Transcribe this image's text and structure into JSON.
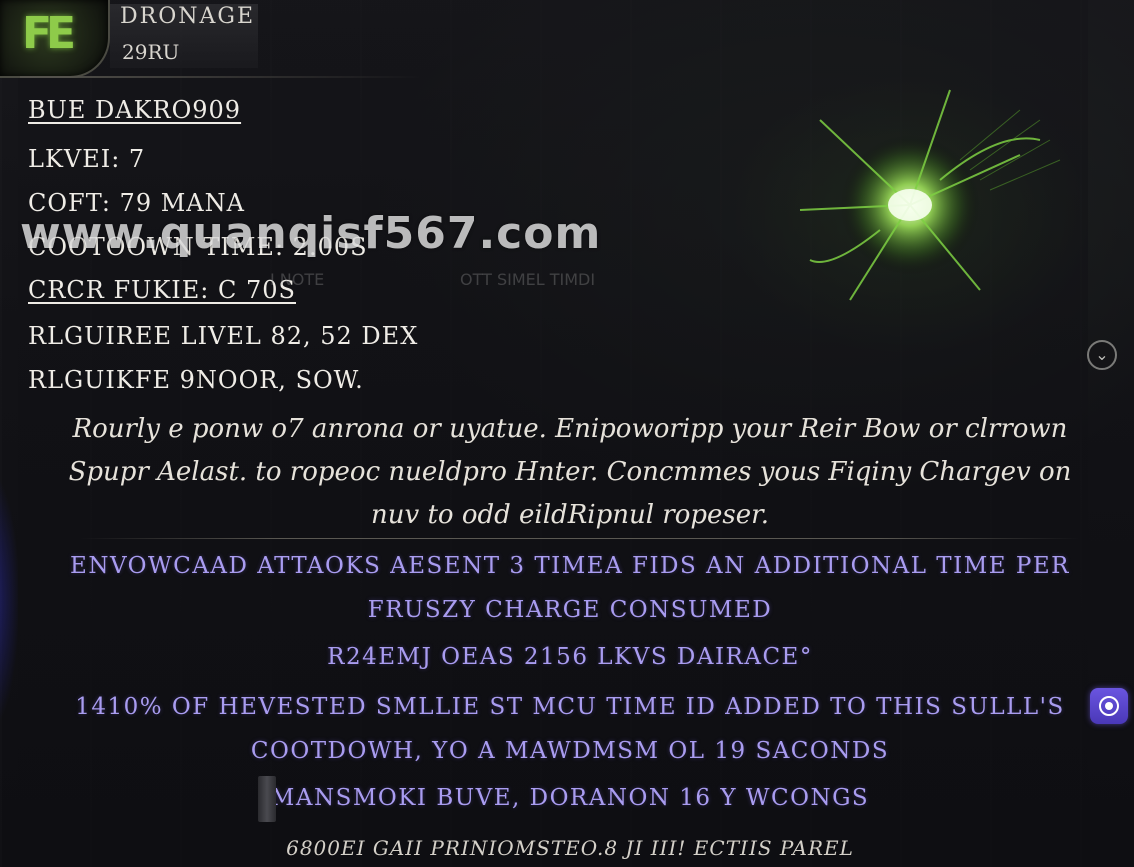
{
  "header": {
    "skill_name": "DRONAGE",
    "skill_sub": "29RU"
  },
  "stats": [
    {
      "text": "BUE DAKRO909",
      "underlined": true
    },
    {
      "text": "LKVEI: 7",
      "underlined": false
    },
    {
      "text": "COFT: 79 MANA",
      "underlined": false
    },
    {
      "text": "COOTOOWN TIME: 2.00S",
      "underlined": false
    },
    {
      "text": "CRCR FUKIE: C 70S",
      "underlined": true
    },
    {
      "text": "RLGUIREE LIVEL 82, 52 DEX",
      "underlined": false
    },
    {
      "text": "RLGUIKFE 9NOOR, SOW.",
      "underlined": false
    }
  ],
  "description": {
    "line1": "Rourly e ponw o7 anrona or uyatue. Enipoworipp your Reir Bow or clrrown",
    "line2": "Spupr Aelast. to ropeoc nueldpro Hnter. Concmmes yous Fiqiny Chargev on",
    "line3": "nuv to odd eildRipnul ropeser."
  },
  "modifiers": [
    "ENVOWCAAD ATTAOKS AESENT 3 TIMEA FIDS AN ADDITIONAL TIME PER",
    "FRUSZY CHARGE CONSUMED",
    "R24EMJ OEAS 2156 LKVS DAIRACE°",
    "1410% OF HEVESTED SMLLIE ST MCU TIME ID ADDED TO THIS SULLL'S",
    "COOTDOWH, YO A MAWDMSM OL 19 SACONDS",
    "MANSMOKI BUVE, DORANON 16 Y WCONGS"
  ],
  "footer": "6800EI GAII PRINIOMSTEO.8 JI III! ECTIIS PAREL",
  "watermark": "www.quanqisf567.com",
  "faint_overlay": [
    "I NOTE",
    "OTT SIMEL TIMDI"
  ],
  "icons": {
    "skill_icon": "skill-emblem-icon",
    "chevron": "chevron-down-icon",
    "assist": "assist-lens-icon"
  },
  "colors": {
    "modifier_text": "#a99cf0",
    "skill_icon_glow": "#8ecb4a",
    "assist_button": "#5a46cc"
  }
}
